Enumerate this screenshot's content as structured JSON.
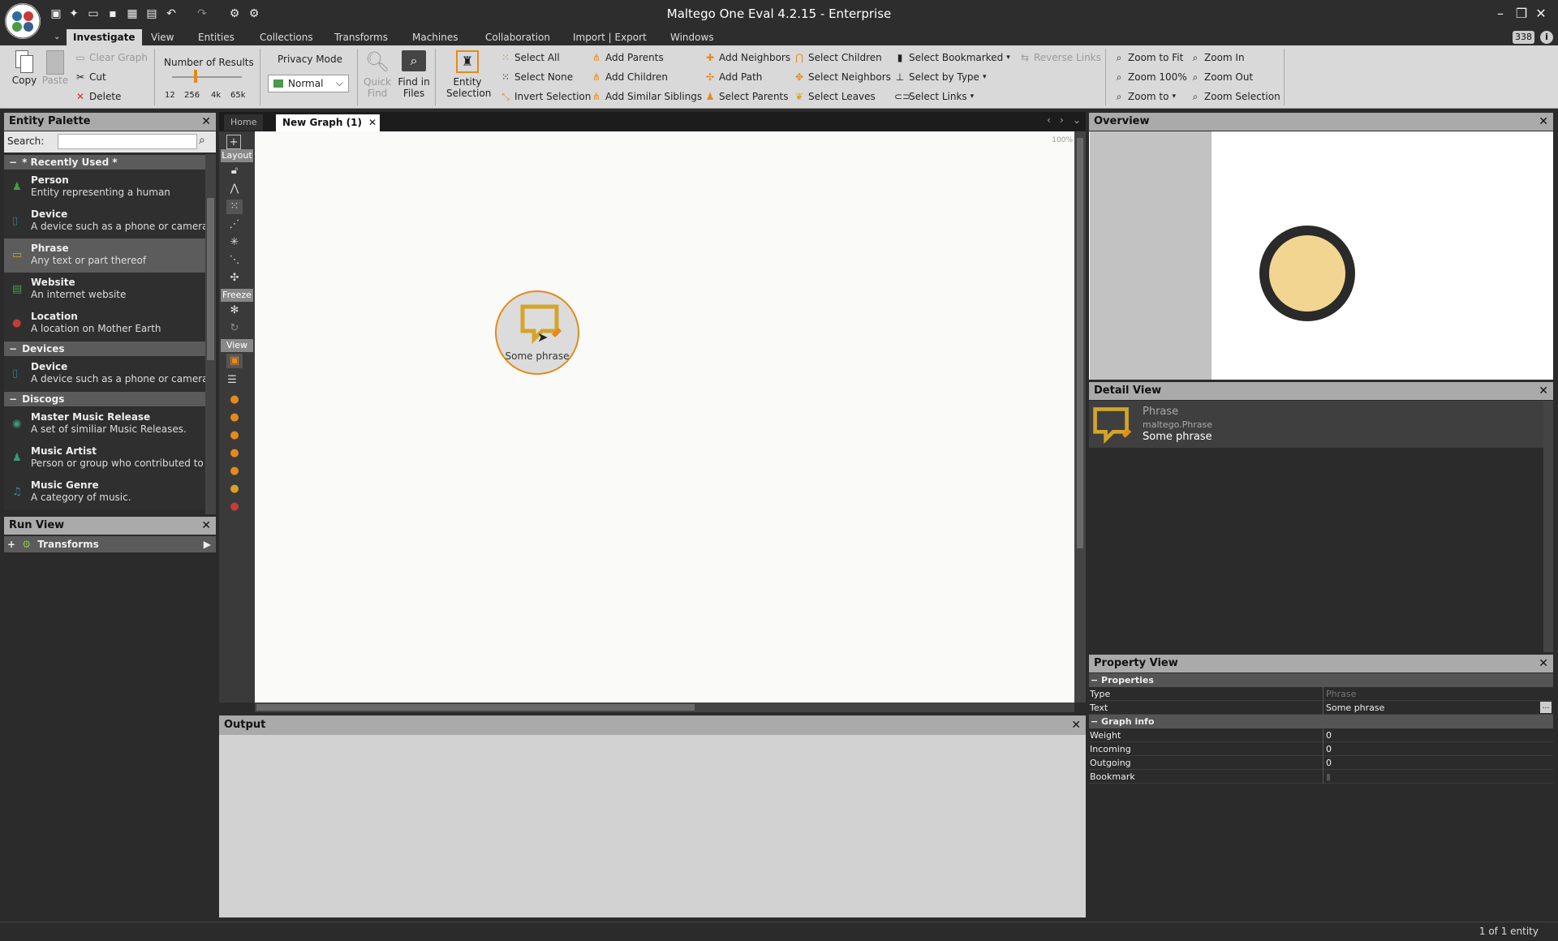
{
  "window": {
    "title": "Maltego One Eval 4.2.15 - Enterprise",
    "counter": "338"
  },
  "menu": {
    "tabs": [
      "Investigate",
      "View",
      "Entities",
      "Collections",
      "Transforms",
      "Machines",
      "Collaboration",
      "Import | Export",
      "Windows"
    ]
  },
  "ribbon": {
    "copy": "Copy",
    "paste": "Paste",
    "clear_graph": "Clear Graph",
    "cut": "Cut",
    "delete": "Delete",
    "number_of_results": "Number of Results",
    "results_ticks": [
      "12",
      "256",
      "4k",
      "65k"
    ],
    "results_level": "256",
    "privacy_mode": "Privacy Mode",
    "privacy_value": "Normal",
    "quick_find": [
      "Quick",
      "Find"
    ],
    "find_in_files": [
      "Find in",
      "Files"
    ],
    "entity_selection": [
      "Entity",
      "Selection"
    ],
    "select_all": "Select All",
    "select_none": "Select None",
    "invert_selection": "Invert Selection",
    "add_parents": "Add Parents",
    "add_children": "Add Children",
    "add_similar_siblings": "Add Similar Siblings",
    "add_neighbors": "Add Neighbors",
    "add_path": "Add Path",
    "select_parents": "Select Parents",
    "select_children": "Select Children",
    "select_neighbors": "Select Neighbors",
    "select_leaves": "Select Leaves",
    "select_bookmarked": "Select Bookmarked",
    "select_by_type": "Select by Type",
    "select_links": "Select Links",
    "reverse_links": "Reverse Links",
    "zoom_to_fit": "Zoom to Fit",
    "zoom_100": "Zoom 100%",
    "zoom_to": "Zoom to",
    "zoom_in": "Zoom In",
    "zoom_out": "Zoom Out",
    "zoom_selection": "Zoom Selection"
  },
  "palette": {
    "title": "Entity Palette",
    "search_label": "Search:",
    "search_value": "",
    "groups": [
      {
        "label": "* Recently Used *"
      },
      {
        "label": "Devices"
      },
      {
        "label": "Discogs"
      }
    ],
    "items": [
      {
        "name": "Person",
        "desc": "Entity representing a human",
        "color": "#4a9a4a"
      },
      {
        "name": "Device",
        "desc": "A device such as a phone or camera",
        "color": "#2e7d8a"
      },
      {
        "name": "Phrase",
        "desc": "Any text or part thereof",
        "color": "#d4a52a"
      },
      {
        "name": "Website",
        "desc": "An internet website",
        "color": "#4a9a4a"
      },
      {
        "name": "Location",
        "desc": "A location on Mother Earth",
        "color": "#c83a3a"
      },
      {
        "name": "Device",
        "desc": "A device such as a phone or camera",
        "color": "#2e7d8a"
      },
      {
        "name": "Master Music Release",
        "desc": "A set of similiar Music Releases.",
        "color": "#3a9a7a"
      },
      {
        "name": "Music Artist",
        "desc": "Person or group who contributed to a",
        "color": "#3a9a7a"
      },
      {
        "name": "Music Genre",
        "desc": "A category of music.",
        "color": "#3a8aaa"
      }
    ]
  },
  "run_view": {
    "title": "Run View",
    "transforms": "Transforms"
  },
  "graph": {
    "tabs": [
      "Home",
      "New Graph (1)"
    ],
    "zoom": "100%",
    "node_label": "Some phrase",
    "tool_headers": [
      "Layout",
      "Freeze",
      "View"
    ]
  },
  "output": {
    "title": "Output"
  },
  "overview": {
    "title": "Overview"
  },
  "detail": {
    "title": "Detail View",
    "type": "Phrase",
    "type_id": "maltego.Phrase",
    "value": "Some phrase"
  },
  "properties": {
    "title": "Property View",
    "section1": "Properties",
    "section2": "Graph info",
    "rows1": [
      {
        "key": "Type",
        "value": "Phrase"
      },
      {
        "key": "Text",
        "value": "Some phrase"
      }
    ],
    "rows2": [
      {
        "key": "Weight",
        "value": "0"
      },
      {
        "key": "Incoming",
        "value": "0"
      },
      {
        "key": "Outgoing",
        "value": "0"
      },
      {
        "key": "Bookmark",
        "value": ""
      }
    ]
  },
  "status": {
    "text": "1 of 1 entity"
  },
  "colors": {
    "accent": "#d4a52a",
    "node_fill": "#f2d590",
    "overview_ring": "#2a2a2a"
  }
}
